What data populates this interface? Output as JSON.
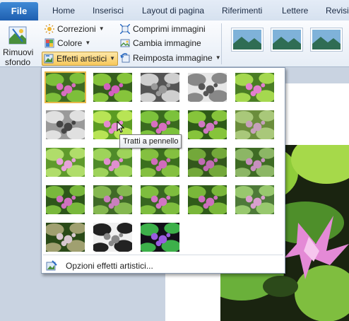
{
  "tabs": {
    "file": "File",
    "home": "Home",
    "insert": "Inserisci",
    "page_layout": "Layout di pagina",
    "references": "Riferimenti",
    "mailings": "Lettere",
    "review": "Revisio"
  },
  "ribbon": {
    "remove_bg_line1": "Rimuovi",
    "remove_bg_line2": "sfondo",
    "corrections": "Correzioni",
    "color": "Colore",
    "artistic_effects": "Effetti artistici",
    "compress": "Comprimi immagini",
    "change_picture": "Cambia immagine",
    "reset_picture": "Reimposta immagine"
  },
  "gallery": {
    "tooltip": "Tratti a pennello",
    "options": "Opzioni effetti artistici...",
    "effects": [
      {
        "style": "normal"
      },
      {
        "style": "marker"
      },
      {
        "style": "pencil-gray"
      },
      {
        "style": "line-drawing"
      },
      {
        "style": "chalk"
      },
      {
        "style": "charcoal"
      },
      {
        "style": "paint-strokes"
      },
      {
        "style": "paint-brush"
      },
      {
        "style": "glow-diffused"
      },
      {
        "style": "blur"
      },
      {
        "style": "light-screen"
      },
      {
        "style": "watercolor"
      },
      {
        "style": "cutout"
      },
      {
        "style": "film-grain"
      },
      {
        "style": "mosaic"
      },
      {
        "style": "glass"
      },
      {
        "style": "cement"
      },
      {
        "style": "texturizer"
      },
      {
        "style": "crisscross"
      },
      {
        "style": "pastels"
      },
      {
        "style": "plastic-wrap"
      },
      {
        "style": "photocopy"
      },
      {
        "style": "glow-edges"
      }
    ]
  },
  "colors": {
    "accent": "#2b6cc4",
    "selected_border": "#e8b94a",
    "leaf": "#6ab03a",
    "flower": "#d86fc0"
  }
}
